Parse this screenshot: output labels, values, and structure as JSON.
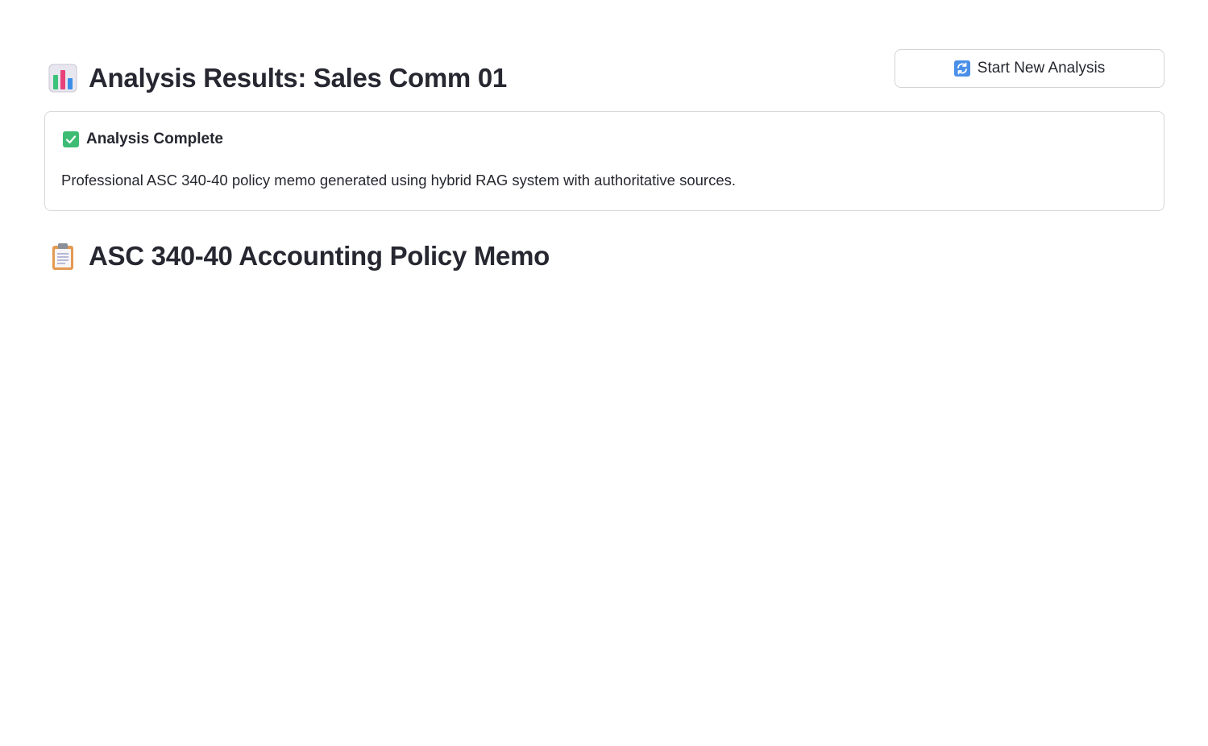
{
  "header": {
    "title_icon": "bar-chart-icon",
    "title": "Analysis Results: Sales Comm 01",
    "new_analysis_icon": "refresh-icon",
    "new_analysis_label": "Start New Analysis"
  },
  "status": {
    "icon": "check-mark-icon",
    "heading": "Analysis Complete",
    "message": "Professional ASC 340-40 policy memo generated using hybrid RAG system with authoritative sources.",
    "accent_color": "#3dbd74"
  },
  "memo": {
    "icon": "clipboard-icon",
    "title": "ASC 340-40 Accounting Policy Memo"
  }
}
